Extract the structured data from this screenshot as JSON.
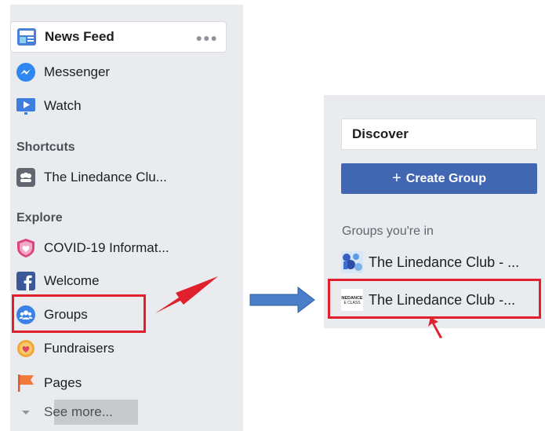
{
  "sidebar": {
    "items": [
      {
        "label": "News Feed"
      },
      {
        "label": "Messenger"
      },
      {
        "label": "Watch"
      }
    ],
    "shortcuts_heading": "Shortcuts",
    "shortcut_items": [
      {
        "label": "The Linedance Clu..."
      }
    ],
    "explore_heading": "Explore",
    "explore_items": [
      {
        "label": "COVID-19 Informat..."
      },
      {
        "label": "Welcome"
      },
      {
        "label": "Groups"
      },
      {
        "label": "Fundraisers"
      },
      {
        "label": "Pages"
      }
    ],
    "see_more": "See more..."
  },
  "groups_panel": {
    "discover": "Discover",
    "create_button": "Create Group",
    "create_plus": "+",
    "groups_heading": "Groups you're in",
    "groups": [
      {
        "name": "The Linedance Club - ..."
      },
      {
        "name": "The Linedance Club -..."
      }
    ],
    "thumb_text": [
      "NEDANCE",
      "E CLASS"
    ]
  },
  "colors": {
    "accent": "#4267b2",
    "highlight": "#e0202c",
    "transition_arrow": "#4a7ec9"
  }
}
